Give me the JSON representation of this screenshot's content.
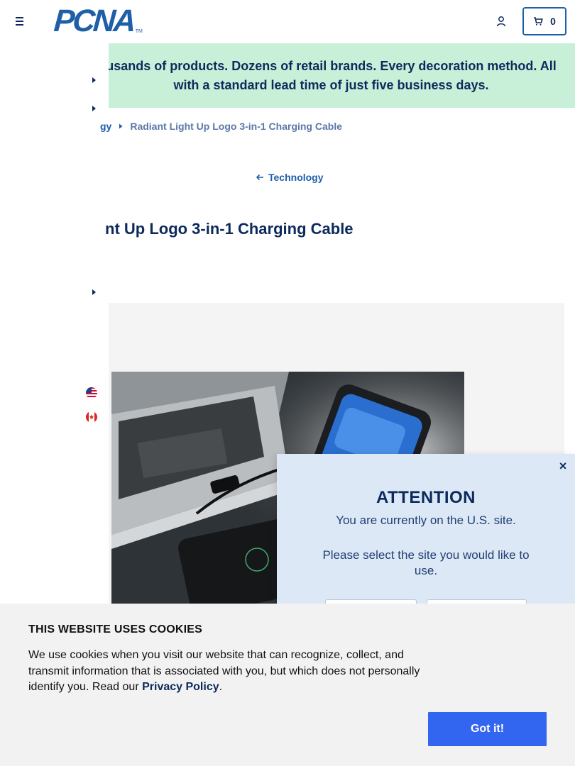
{
  "header": {
    "logo_text": "PCNA",
    "logo_tm": "TM",
    "cart_count": "0"
  },
  "banner": {
    "text": "Thousands of products. Dozens of retail brands. Every decoration method. All with a standard lead time of just five business days.",
    "visible_text": "usands of products. Dozens of retail brands. Every decoration method. All with a standard lead time of just five business days."
  },
  "breadcrumb": {
    "parent_visible": "gy",
    "current": "Radiant Light Up Logo 3-in-1 Charging Cable"
  },
  "back_link": {
    "label": "Technology"
  },
  "product": {
    "title_visible": "nt Up Logo 3-in-1 Charging Cable"
  },
  "attention": {
    "title": "ATTENTION",
    "line1": "You are currently on the U.S. site.",
    "line2": "Please select the site you would like to use.",
    "close_symbol": "×"
  },
  "cookie": {
    "title": "THIS WEBSITE USES COOKIES",
    "body_prefix": "We use cookies when you visit our website that can recognize, collect, and transmit information that is associated with you, but which does not personally identify you. Read our ",
    "link_label": "Privacy Policy",
    "body_suffix": ".",
    "button_label": "Got it!"
  },
  "colors": {
    "navy": "#0d2a5c",
    "brand_blue": "#1f5fa8",
    "banner_green": "#c8f0d8",
    "modal_bg": "#dde8f6",
    "cookie_button": "#3366f0"
  }
}
